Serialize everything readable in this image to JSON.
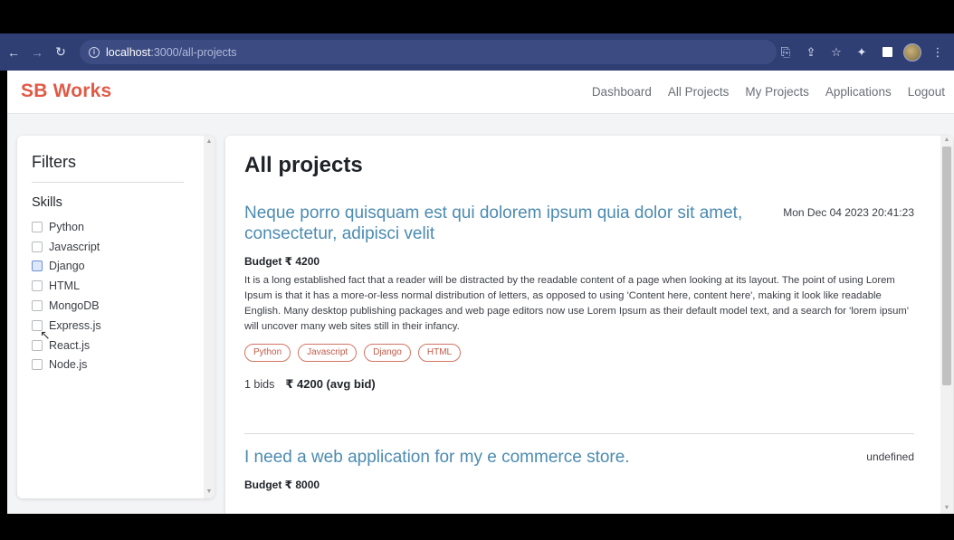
{
  "browser": {
    "url_host": "localhost",
    "url_path": ":3000/all-projects",
    "info_icon": "i"
  },
  "app": {
    "brand": "SB Works",
    "nav": [
      "Dashboard",
      "All Projects",
      "My Projects",
      "Applications",
      "Logout"
    ]
  },
  "filters": {
    "title": "Filters",
    "skills_label": "Skills",
    "skills": [
      "Python",
      "Javascript",
      "Django",
      "HTML",
      "MongoDB",
      "Express.js",
      "React.js",
      "Node.js"
    ]
  },
  "projects": {
    "heading": "All projects",
    "items": [
      {
        "title": "Neque porro quisquam est qui dolorem ipsum quia dolor sit amet, consectetur, adipisci velit",
        "date": "Mon Dec 04 2023 20:41:23",
        "budget": "Budget ₹ 4200",
        "description": "It is a long established fact that a reader will be distracted by the readable content of a page when looking at its layout. The point of using Lorem Ipsum is that it has a more-or-less normal distribution of letters, as opposed to using 'Content here, content here', making it look like readable English. Many desktop publishing packages and web page editors now use Lorem Ipsum as their default model text, and a search for 'lorem ipsum' will uncover many web sites still in their infancy.",
        "tags": [
          "Python",
          "Javascript",
          "Django",
          "HTML"
        ],
        "bids_count": "1 bids",
        "avg_bid": "₹ 4200 (avg bid)"
      },
      {
        "title": "I need a web application for my e commerce store.",
        "date": "undefined",
        "budget": "Budget ₹ 8000"
      }
    ]
  },
  "colors": {
    "brand": "#e05a46",
    "project_title": "#4c8bb1",
    "tag_border": "#d27563",
    "browser_bar": "#2f3f74"
  }
}
